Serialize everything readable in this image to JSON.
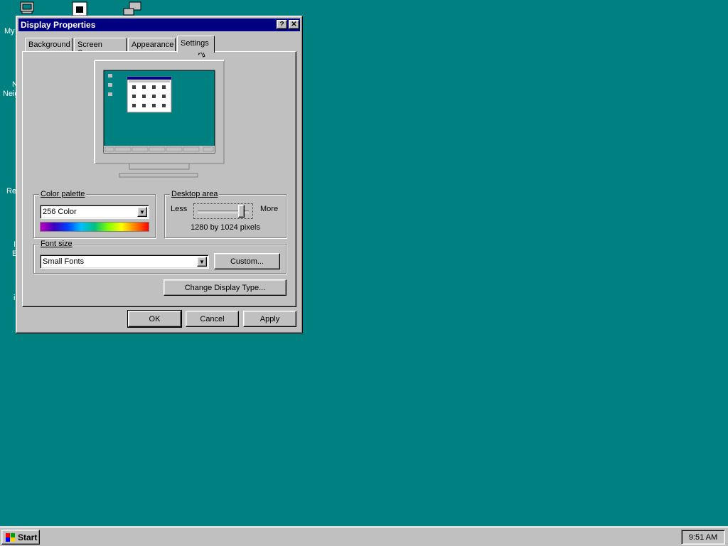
{
  "desktop": {
    "icon_labels": [
      "My",
      "N",
      "Neig",
      "Re",
      "I",
      "E",
      "i"
    ]
  },
  "window": {
    "title": "Display Properties",
    "help_button": "?",
    "close_button": "✕"
  },
  "tabs": [
    {
      "label": "Background"
    },
    {
      "label": "Screen Saver"
    },
    {
      "label": "Appearance"
    },
    {
      "label": "Settings"
    }
  ],
  "color_palette": {
    "label": "Color palette",
    "selected": "256 Color"
  },
  "desktop_area": {
    "label": "Desktop area",
    "less": "Less",
    "more": "More",
    "resolution": "1280 by 1024 pixels",
    "slider_position": 0.9
  },
  "font_size": {
    "label": "Font size",
    "selected": "Small Fonts",
    "custom_button": "Custom..."
  },
  "buttons": {
    "change_display_type": "Change Display Type...",
    "ok": "OK",
    "cancel": "Cancel",
    "apply": "Apply"
  },
  "taskbar": {
    "start_label": "Start",
    "clock": "9:51 AM"
  },
  "colors": {
    "desktop": "#008080",
    "titlebar": "#000080",
    "face": "#c0c0c0"
  }
}
